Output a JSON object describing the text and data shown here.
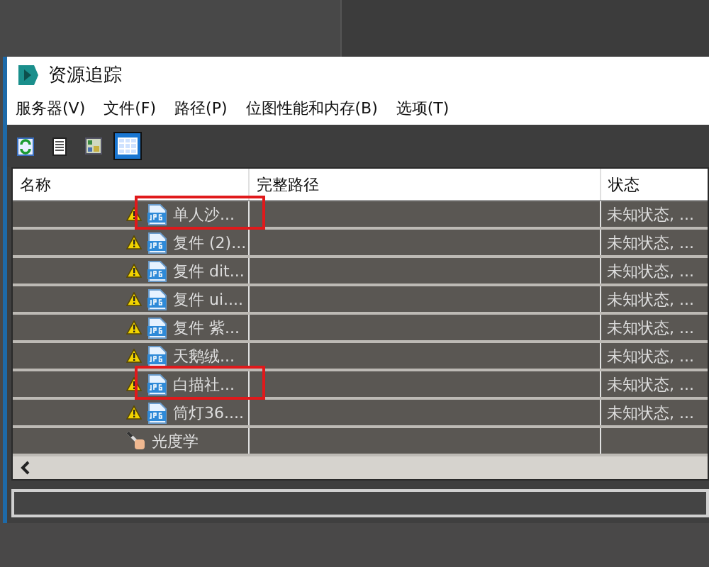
{
  "window": {
    "title": "资源追踪"
  },
  "menu": [
    "服务器(V)",
    "文件(F)",
    "路径(P)",
    "位图性能和内存(B)",
    "选项(T)"
  ],
  "toolbar": [
    {
      "kind": "refresh",
      "selected": false
    },
    {
      "kind": "list",
      "selected": false
    },
    {
      "kind": "thumbnail",
      "selected": false
    },
    {
      "kind": "table",
      "selected": true
    }
  ],
  "table": {
    "columns": [
      "名称",
      "完整路径",
      "状态"
    ],
    "rows": [
      {
        "kind": "bitmap",
        "name": "单人沙...",
        "status": "未知状态, ...",
        "warning": true,
        "highlighted": true
      },
      {
        "kind": "bitmap",
        "name": "复件 (2)...",
        "status": "未知状态, ...",
        "warning": true,
        "highlighted": false
      },
      {
        "kind": "bitmap",
        "name": "复件 dit...",
        "status": "未知状态, ...",
        "warning": true,
        "highlighted": false
      },
      {
        "kind": "bitmap",
        "name": "复件 ui....",
        "status": "未知状态, ...",
        "warning": true,
        "highlighted": false
      },
      {
        "kind": "bitmap",
        "name": "复件 紫...",
        "status": "未知状态, ...",
        "warning": true,
        "highlighted": false
      },
      {
        "kind": "bitmap",
        "name": "天鹅绒...",
        "status": "未知状态, ...",
        "warning": true,
        "highlighted": false
      },
      {
        "kind": "bitmap",
        "name": "白描社...",
        "status": "未知状态, ...",
        "warning": true,
        "highlighted": true
      },
      {
        "kind": "bitmap",
        "name": "筒灯36....",
        "status": "未知状态, ...",
        "warning": true,
        "highlighted": false
      },
      {
        "kind": "photometric",
        "name": "光度学",
        "warning": false,
        "highlighted": false
      }
    ]
  }
}
